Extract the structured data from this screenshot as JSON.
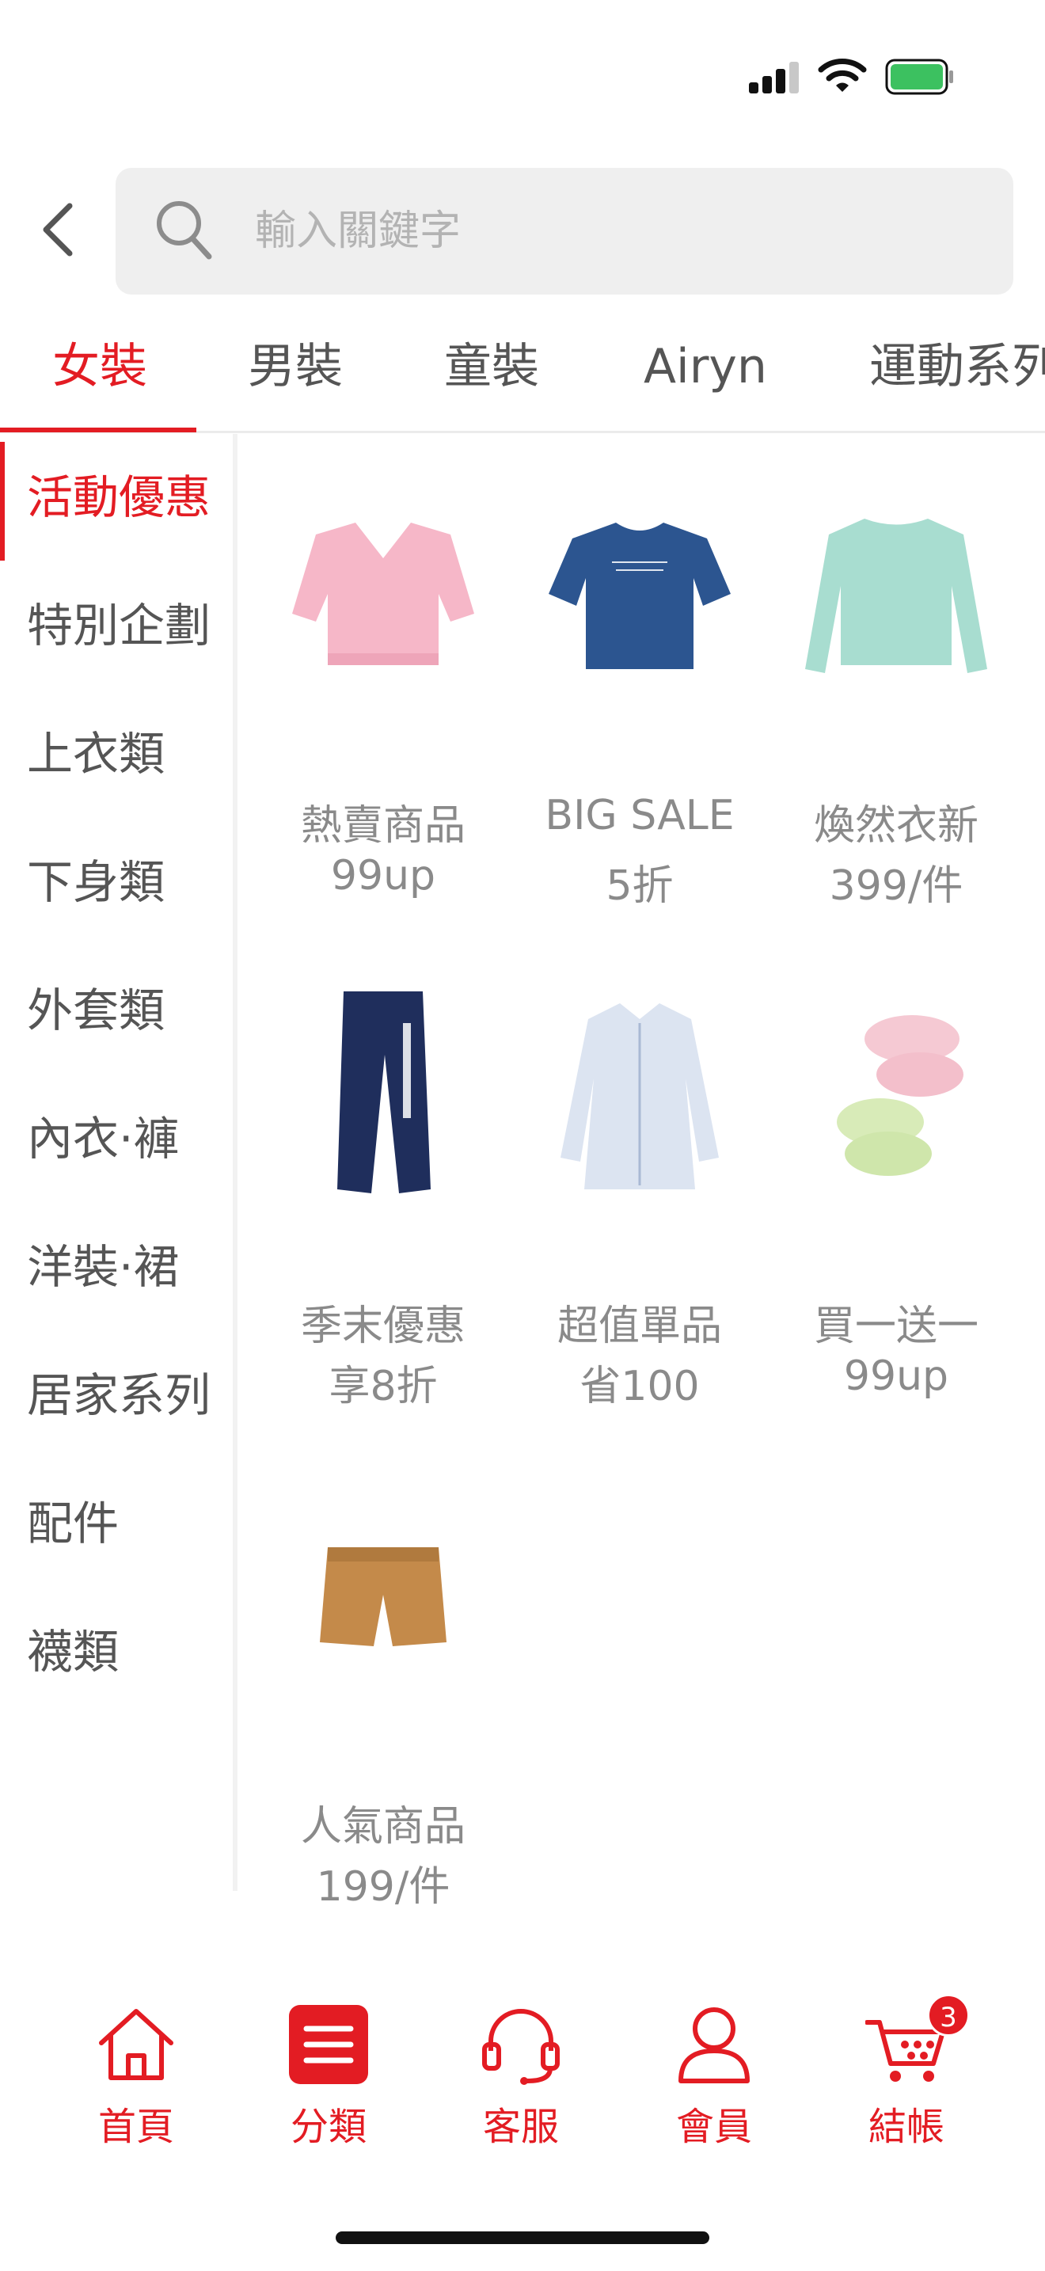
{
  "colors": {
    "accent": "#e31c23",
    "text": "#555555",
    "muted": "#8a8a8a",
    "search_bg": "#efefef"
  },
  "status_bar": {
    "icons": [
      "signal-icon",
      "wifi-icon",
      "battery-icon"
    ]
  },
  "search": {
    "placeholder": "輸入關鍵字"
  },
  "top_tabs": [
    {
      "label": "女裝",
      "active": true
    },
    {
      "label": "男裝"
    },
    {
      "label": "童裝"
    },
    {
      "label": "Airyn"
    },
    {
      "label": "運動系列"
    }
  ],
  "sidebar": {
    "items": [
      {
        "label": "活動優惠",
        "active": true
      },
      {
        "label": "特別企劃"
      },
      {
        "label": "上衣類"
      },
      {
        "label": "下身類"
      },
      {
        "label": "外套類"
      },
      {
        "label": "內衣·褲"
      },
      {
        "label": "洋裝·裙"
      },
      {
        "label": "居家系列"
      },
      {
        "label": "配件"
      },
      {
        "label": "襪類"
      }
    ]
  },
  "grid": {
    "tiles": [
      {
        "line1": "熱賣商品",
        "line2": "99up",
        "image": "pink-top-image"
      },
      {
        "line1": "BIG SALE",
        "line2": "5折",
        "image": "navy-tee-image"
      },
      {
        "line1": "煥然衣新",
        "line2": "399/件",
        "image": "mint-sweater-image"
      },
      {
        "line1": "季末優惠",
        "line2": "享8折",
        "image": "navy-joggers-image"
      },
      {
        "line1": "超值單品",
        "line2": "省100",
        "image": "striped-shirt-image"
      },
      {
        "line1": "買一送一",
        "line2": "99up",
        "image": "socks-image"
      },
      {
        "line1": "人氣商品",
        "line2": "199/件",
        "image": "tan-shorts-image"
      }
    ]
  },
  "bottom_nav": {
    "items": [
      {
        "label": "首頁",
        "icon": "home-icon"
      },
      {
        "label": "分類",
        "icon": "category-icon",
        "active": true
      },
      {
        "label": "客服",
        "icon": "headset-icon"
      },
      {
        "label": "會員",
        "icon": "user-icon"
      },
      {
        "label": "結帳",
        "icon": "cart-icon"
      }
    ],
    "cart_count": "3"
  }
}
